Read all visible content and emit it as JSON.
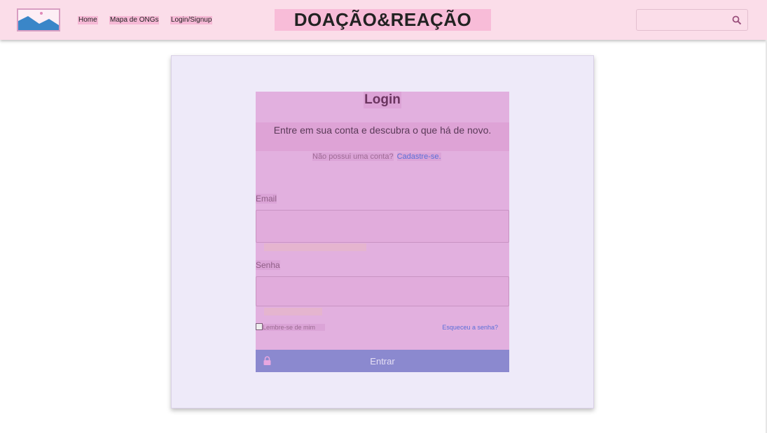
{
  "nav": {
    "links": [
      "Home",
      "Mapa de ONGs",
      "Login/Signup"
    ],
    "brand": "DOAÇÃO&REAÇÃO",
    "search_placeholder": ""
  },
  "login": {
    "title": "Login",
    "subtitle": "Entre em sua conta e descubra o que há de novo.",
    "signup_question": "Não possui uma conta?",
    "signup_link": "Cadastre-se.",
    "email_label": "Email",
    "email_value": "",
    "password_label": "Senha",
    "password_value": "",
    "remember_label": "Lembre-se de mim",
    "remember_checked": false,
    "forgot_link": "Esqueceu a senha?",
    "submit_label": "Entrar"
  },
  "colors": {
    "navbar": "#fbdde9",
    "card": "#eeeaf9",
    "form": "#e2b0df",
    "button": "#8b89cf",
    "link": "#5b6fd8"
  },
  "icons": [
    "logo-image-icon",
    "search-icon",
    "lock-icon"
  ]
}
